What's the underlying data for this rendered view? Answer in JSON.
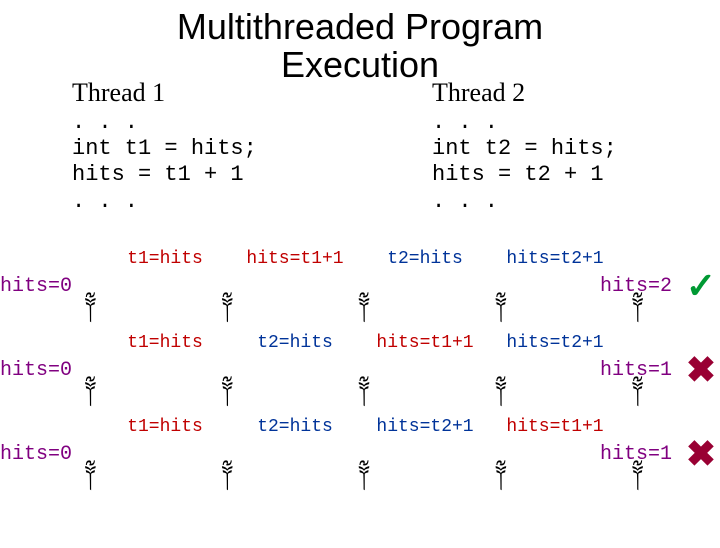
{
  "title_line1": "Multithreaded Program",
  "title_line2": "Execution",
  "thread1": {
    "title": "Thread 1",
    "code": ". . .\nint t1 = hits;\nhits = t1 + 1\n. . ."
  },
  "thread2": {
    "title": "Thread 2",
    "code": ". . .\nint t2 = hits;\nhits = t2 + 1\n. . ."
  },
  "mark_glyph": "༈",
  "good_glyph": "✓",
  "bad_glyph": "✖",
  "traces": [
    {
      "start": "hits=0",
      "ops": [
        {
          "text": "t1=hits",
          "color": "red"
        },
        {
          "text": "hits=t1+1",
          "color": "red"
        },
        {
          "text": "t2=hits",
          "color": "blue"
        },
        {
          "text": "hits=t2+1",
          "color": "blue"
        }
      ],
      "result": "hits=2",
      "verdict": "good"
    },
    {
      "start": "hits=0",
      "ops": [
        {
          "text": "t1=hits",
          "color": "red"
        },
        {
          "text": "t2=hits",
          "color": "blue"
        },
        {
          "text": "hits=t1+1",
          "color": "red"
        },
        {
          "text": "hits=t2+1",
          "color": "blue"
        }
      ],
      "result": "hits=1",
      "verdict": "bad"
    },
    {
      "start": "hits=0",
      "ops": [
        {
          "text": "t1=hits",
          "color": "red"
        },
        {
          "text": "t2=hits",
          "color": "blue"
        },
        {
          "text": "hits=t2+1",
          "color": "blue"
        },
        {
          "text": "hits=t1+1",
          "color": "red"
        }
      ],
      "result": "hits=1",
      "verdict": "bad"
    }
  ]
}
